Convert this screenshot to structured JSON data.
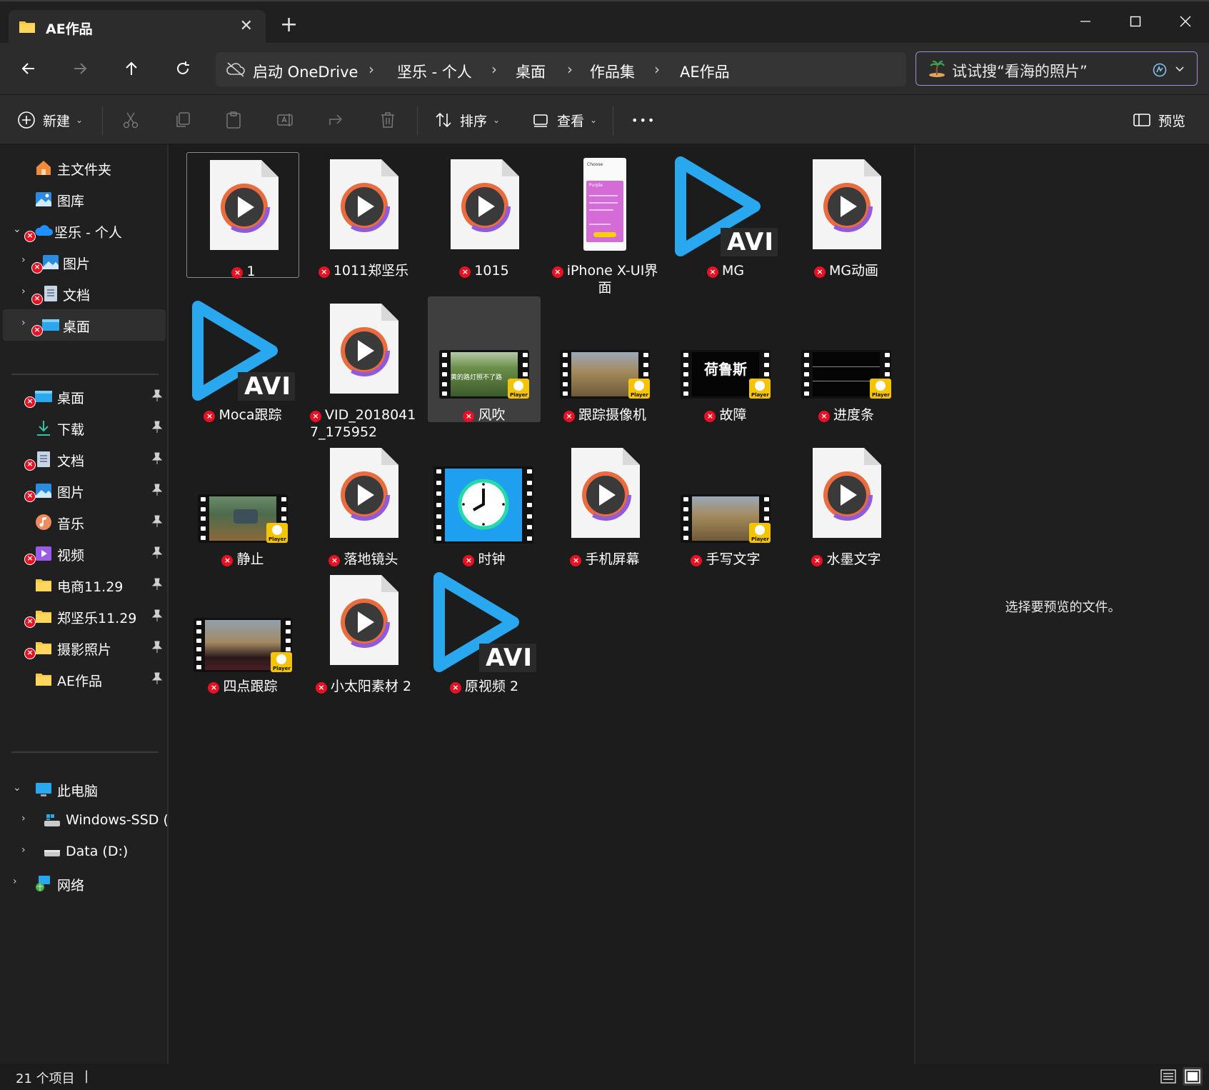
{
  "tab": {
    "title": "AE作品",
    "close": "✕",
    "new": "+"
  },
  "window_controls": {
    "minimize": "—",
    "maximize": "☐",
    "close": "✕"
  },
  "breadcrumb": [
    "启动 OneDrive",
    "坚乐 - 个人",
    "桌面",
    "作品集",
    "AE作品"
  ],
  "breadcrumb_sep": "›",
  "search": {
    "placeholder": "试试搜“看海的照片”"
  },
  "commands": {
    "new": "新建",
    "sort": "排序",
    "view": "查看",
    "more": "•••",
    "preview": "预览"
  },
  "sidebar": {
    "home": "主文件夹",
    "gallery": "图库",
    "onedrive": "坚乐 - 个人",
    "od_pictures": "图片",
    "od_documents": "文档",
    "od_desktop": "桌面",
    "quick": [
      "桌面",
      "下载",
      "文档",
      "图片",
      "音乐",
      "视频",
      "电商11.29",
      "郑坚乐11.29",
      "摄影照片",
      "AE作品"
    ],
    "thispc": "此电脑",
    "drive_c": "Windows-SSD (C",
    "drive_d": "Data (D:)",
    "network": "网络"
  },
  "files": [
    {
      "name": "1",
      "kind": "doc"
    },
    {
      "name": "1011郑坚乐",
      "kind": "doc"
    },
    {
      "name": "1015",
      "kind": "doc"
    },
    {
      "name": "iPhone X-UI界面",
      "kind": "phone"
    },
    {
      "name": "MG",
      "kind": "avi"
    },
    {
      "name": "MG动画",
      "kind": "doc"
    },
    {
      "name": "Moca跟踪",
      "kind": "avi"
    },
    {
      "name": "VID_20180417_175952",
      "kind": "doc"
    },
    {
      "name": "风吹",
      "kind": "film"
    },
    {
      "name": "跟踪摄像机",
      "kind": "film"
    },
    {
      "name": "故障",
      "kind": "film"
    },
    {
      "name": "进度条",
      "kind": "film"
    },
    {
      "name": "静止",
      "kind": "film"
    },
    {
      "name": "落地镜头",
      "kind": "doc"
    },
    {
      "name": "时钟",
      "kind": "clock"
    },
    {
      "name": "手机屏幕",
      "kind": "doc"
    },
    {
      "name": "手写文字",
      "kind": "film"
    },
    {
      "name": "水墨文字",
      "kind": "doc"
    },
    {
      "name": "四点跟踪",
      "kind": "film"
    },
    {
      "name": "小太阳素材 2",
      "kind": "doc"
    },
    {
      "name": "原视频 2",
      "kind": "avi"
    }
  ],
  "thumb_text": {
    "avi": "AVI",
    "player": "Player",
    "wind_caption": "黄的路灯照不了路",
    "glitch_caption": "荷鲁斯",
    "phone_title": "Choose",
    "phone_sub": "Purple"
  },
  "preview_pane": {
    "message": "选择要预览的文件。"
  },
  "status": {
    "count": "21 个项目",
    "caret": "|"
  },
  "colors": {
    "accent": "#a38ad8",
    "error": "#e81123",
    "folder": "#f8c93f",
    "avi_blue": "#29a8ef",
    "onedrive": "#1e90ff"
  }
}
